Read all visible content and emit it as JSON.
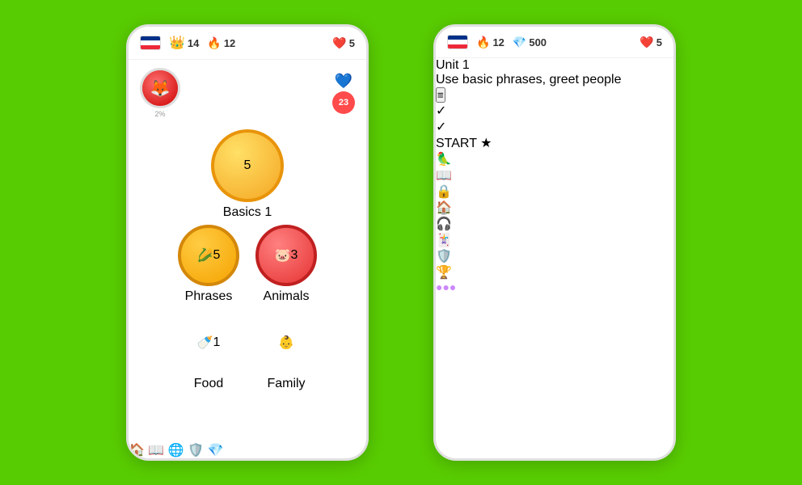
{
  "background_color": "#58cc02",
  "left_phone": {
    "top_bar": {
      "crown_count": "14",
      "fire_count": "12",
      "heart_count": "5"
    },
    "avatar": {
      "progress": "2%",
      "notification_count": "23"
    },
    "lessons": [
      {
        "id": "basics1",
        "label": "Basics 1",
        "badge": "5",
        "type": "single"
      },
      {
        "id": "phrases",
        "label": "Phrases",
        "badge": "5",
        "type": "pair_left"
      },
      {
        "id": "animals",
        "label": "Animals",
        "badge": "3",
        "type": "pair_right"
      },
      {
        "id": "food",
        "label": "Food",
        "badge": "1",
        "type": "pair_left"
      },
      {
        "id": "family",
        "label": "Family",
        "badge": "",
        "type": "pair_right"
      }
    ],
    "nav": [
      {
        "id": "home",
        "icon": "🏠",
        "active": true
      },
      {
        "id": "book",
        "icon": "📖",
        "active": false
      },
      {
        "id": "globe",
        "icon": "🌐",
        "active": false
      },
      {
        "id": "shield",
        "icon": "🛡️",
        "active": false
      },
      {
        "id": "gem",
        "icon": "💎",
        "active": false
      }
    ]
  },
  "right_phone": {
    "top_bar": {
      "fire_count": "12",
      "gem_count": "500",
      "heart_count": "5"
    },
    "unit": {
      "title": "Unit 1",
      "subtitle": "Use basic phrases, greet people",
      "guidebook_label": "≡"
    },
    "skill_nodes": [
      {
        "id": "node1",
        "type": "complete",
        "icon": "✓"
      },
      {
        "id": "node2",
        "type": "complete",
        "icon": "✓"
      },
      {
        "id": "node3",
        "type": "start",
        "icon": "★",
        "label": "START"
      },
      {
        "id": "node4",
        "type": "inactive",
        "icon": "📖"
      },
      {
        "id": "node5",
        "type": "inactive",
        "icon": "🔒"
      }
    ],
    "nav": [
      {
        "id": "home",
        "icon": "🏠",
        "active": true,
        "color": "#ff9600"
      },
      {
        "id": "headphones",
        "icon": "🎧",
        "active": false
      },
      {
        "id": "cards",
        "icon": "🃏",
        "active": false
      },
      {
        "id": "shield",
        "icon": "🛡️",
        "active": false
      },
      {
        "id": "trophy",
        "icon": "🏆",
        "active": false
      },
      {
        "id": "more",
        "icon": "●●●",
        "active": false
      }
    ]
  },
  "arrow": "➤"
}
